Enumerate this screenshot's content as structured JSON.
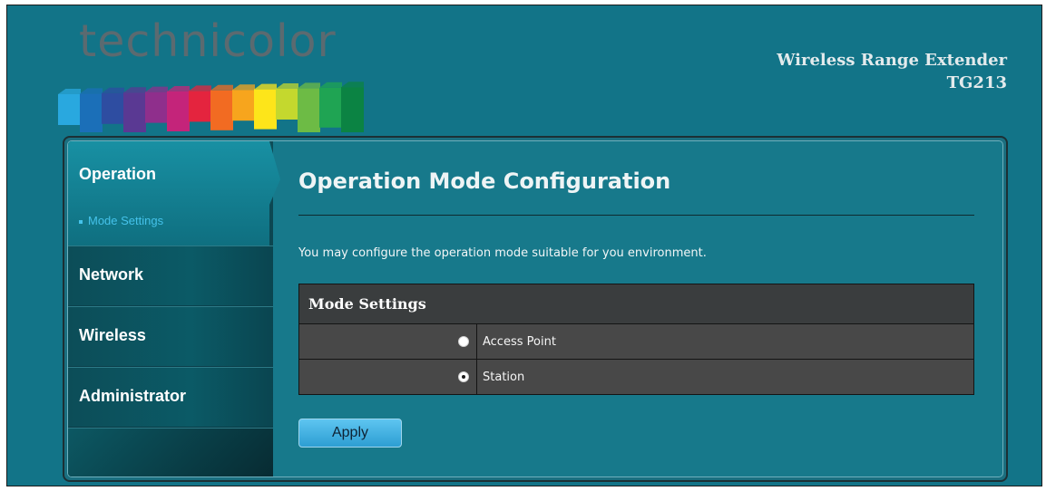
{
  "header": {
    "logo_text": "technicolor",
    "logo_bar_colors": [
      "#29a8df",
      "#1b6fb8",
      "#2e4da1",
      "#5a3993",
      "#8f2f8c",
      "#c4247a",
      "#e4243e",
      "#f26b22",
      "#f7a51d",
      "#fde51a",
      "#c4d82e",
      "#6dbb45",
      "#1fa453",
      "#0b8343"
    ],
    "product_line1": "Wireless Range Extender",
    "product_line2": "TG213"
  },
  "sidebar": {
    "active": {
      "label": "Operation",
      "sub_item": "Mode Settings"
    },
    "items": [
      "Network",
      "Wireless",
      "Administrator"
    ]
  },
  "main": {
    "title": "Operation Mode Configuration",
    "description": "You may configure the operation mode suitable for you environment.",
    "table": {
      "header": "Mode Settings",
      "options": [
        {
          "label": "Access Point",
          "checked": false
        },
        {
          "label": "Station",
          "checked": true
        }
      ]
    },
    "apply_label": "Apply"
  }
}
